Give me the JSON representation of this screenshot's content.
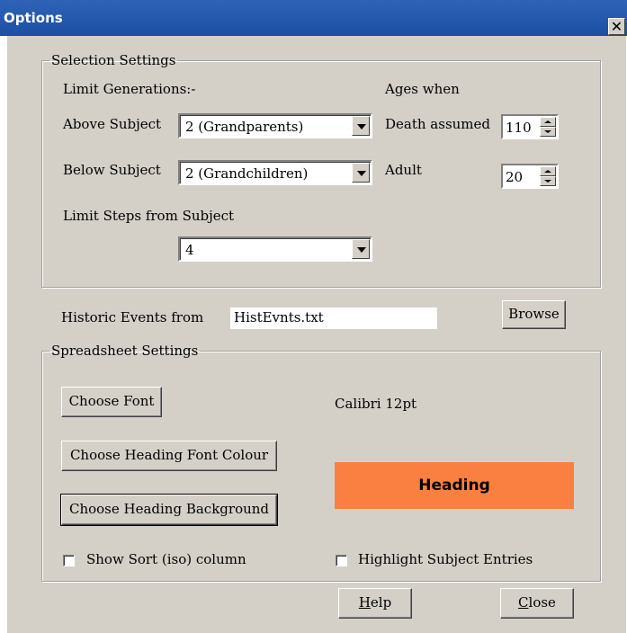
{
  "window": {
    "title": "Options"
  },
  "selection": {
    "legend": "Selection Settings",
    "limit_generations_label": "Limit Generations:-",
    "above_label": "Above Subject",
    "above_value": "2 (Grandparents)",
    "below_label": "Below Subject",
    "below_value": "2 (Grandchildren)",
    "limit_steps_label": "Limit Steps from Subject",
    "limit_steps_value": "4",
    "ages_when_label": "Ages when",
    "death_assumed_label": "Death assumed",
    "death_assumed_value": "110",
    "adult_label": "Adult",
    "adult_value": "20"
  },
  "historic": {
    "label": "Historic Events from",
    "value": "HistEvnts.txt",
    "browse_label": "Browse"
  },
  "spreadsheet": {
    "legend": "Spreadsheet Settings",
    "choose_font_label": "Choose Font",
    "font_display": "Calibri 12pt",
    "choose_heading_font_colour_label": "Choose Heading Font Colour",
    "choose_heading_background_label": "Choose Heading Background",
    "heading_sample": "Heading",
    "heading_bg_color": "#f98041",
    "show_sort_label": "Show Sort (iso) column",
    "show_sort_checked": false,
    "highlight_subject_label": "Highlight Subject Entries",
    "highlight_subject_checked": false
  },
  "footer": {
    "help_mnemonic": "H",
    "help_rest": "elp",
    "close_mnemonic": "C",
    "close_rest": "lose"
  }
}
